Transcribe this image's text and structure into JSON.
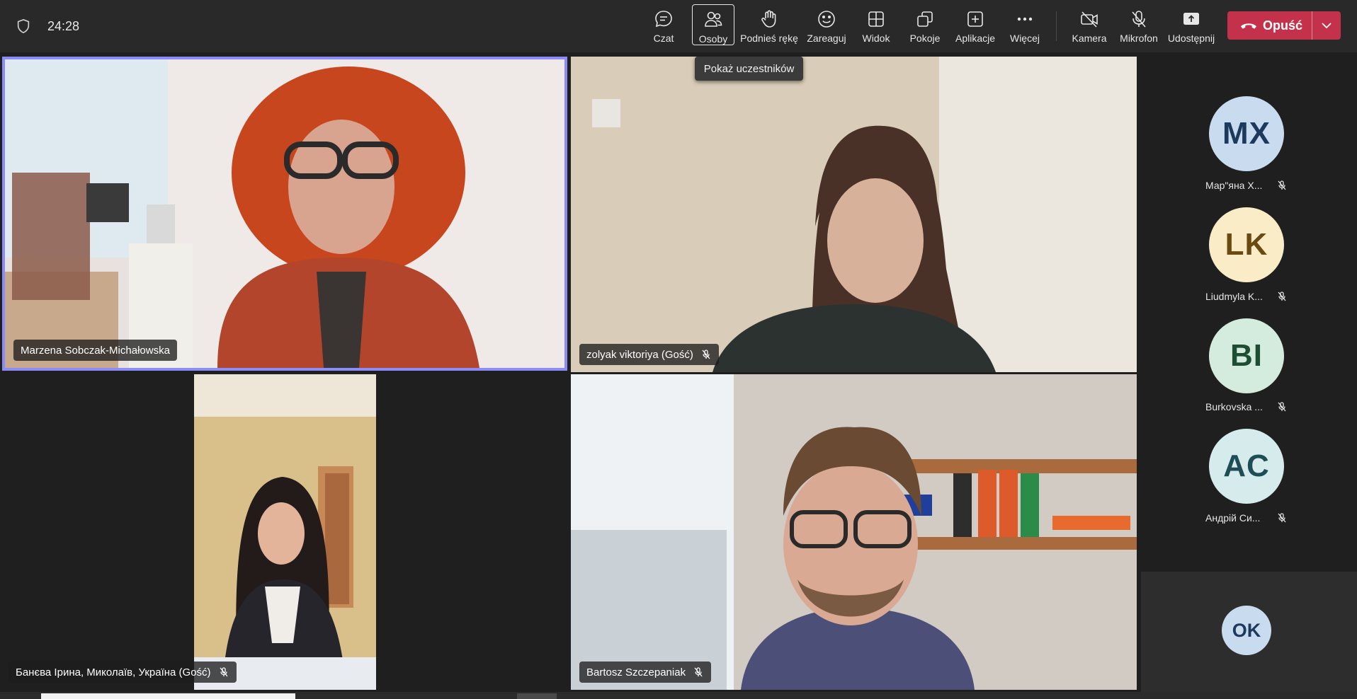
{
  "meeting": {
    "timer": "24:28"
  },
  "toolbar": {
    "items": [
      {
        "label": "Czat",
        "icon": "chat-icon"
      },
      {
        "label": "Osoby",
        "icon": "people-icon"
      },
      {
        "label": "Podnieś rękę",
        "icon": "raise-hand-icon"
      },
      {
        "label": "Zareaguj",
        "icon": "reaction-smiley-icon"
      },
      {
        "label": "Widok",
        "icon": "view-grid-icon"
      },
      {
        "label": "Pokoje",
        "icon": "breakout-rooms-icon"
      },
      {
        "label": "Aplikacje",
        "icon": "apps-add-icon"
      },
      {
        "label": "Więcej",
        "icon": "more-dots-icon"
      },
      {
        "label": "Kamera",
        "icon": "camera-off-icon"
      },
      {
        "label": "Mikrofon",
        "icon": "mic-off-icon"
      },
      {
        "label": "Udostępnij",
        "icon": "share-screen-icon"
      }
    ],
    "leave_label": "Opuść",
    "tooltip": "Pokaż uczestników"
  },
  "tiles": [
    {
      "name": "Marzena Sobczak-Michałowska",
      "muted": false,
      "speaking": true
    },
    {
      "name": "zolyak viktoriya (Gość)",
      "muted": true,
      "speaking": false
    },
    {
      "name": "Банєва Ірина, Миколаїв, Україна (Gość)",
      "muted": true,
      "speaking": false
    },
    {
      "name": "Bartosz Szczepaniak",
      "muted": true,
      "speaking": false
    }
  ],
  "roster": [
    {
      "initials": "MX",
      "name": "Мар\"яна Х...",
      "bg": "#c9dcef",
      "fg": "#1d3a5e"
    },
    {
      "initials": "LK",
      "name": "Liudmyla K...",
      "bg": "#f9ecc7",
      "fg": "#6b4a12"
    },
    {
      "initials": "BI",
      "name": "Burkovska ...",
      "bg": "#d3ecdd",
      "fg": "#1d4d33"
    },
    {
      "initials": "AC",
      "name": "Андрій Си...",
      "bg": "#d6ecec",
      "fg": "#1f4d55"
    }
  ],
  "overflow_avatar": {
    "initials": "OK"
  },
  "colors": {
    "leave": "#c4314b",
    "speaking_border": "#8b8cf7",
    "topbar": "#292929",
    "stage": "#1f1f1f"
  }
}
